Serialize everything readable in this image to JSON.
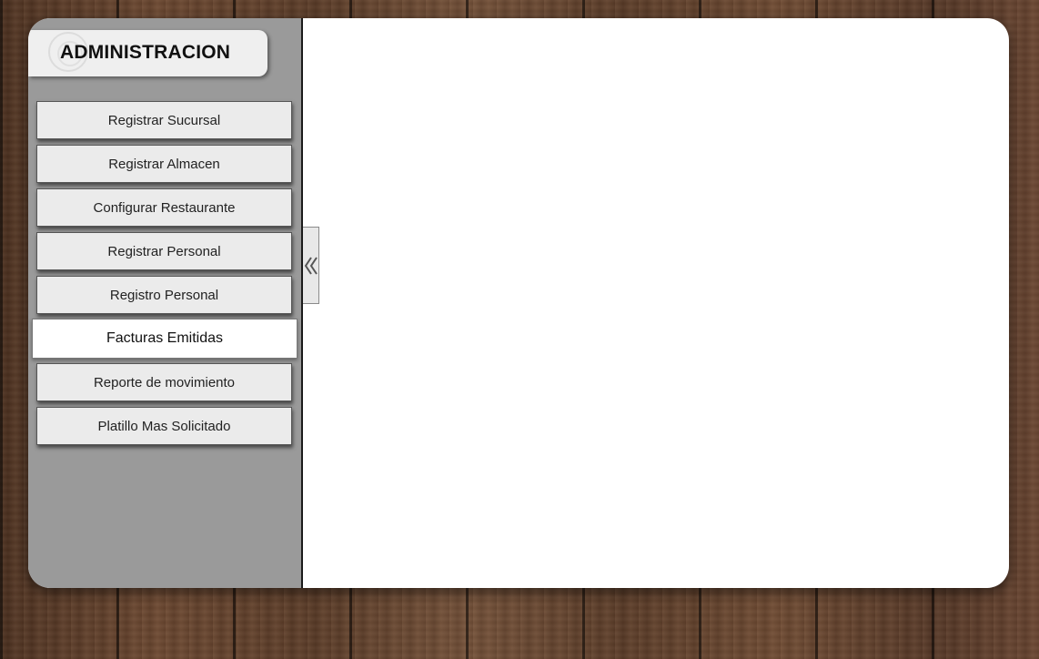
{
  "header": {
    "title": "ADMINISTRACION",
    "logo_icon": "logo-emblem-icon"
  },
  "menu": {
    "items": [
      {
        "label": "Registrar Sucursal",
        "active": false
      },
      {
        "label": "Registrar Almacen",
        "active": false
      },
      {
        "label": "Configurar Restaurante",
        "active": false
      },
      {
        "label": "Registrar Personal",
        "active": false
      },
      {
        "label": "Registro Personal",
        "active": false
      },
      {
        "label": "Facturas Emitidas",
        "active": true
      },
      {
        "label": "Reporte de movimiento",
        "active": false
      },
      {
        "label": "Platillo Mas Solicitado",
        "active": false
      }
    ]
  },
  "collapse_toggle": {
    "icon": "double-chevron-left-icon"
  },
  "colors": {
    "sidebar_bg": "#9a9a9a",
    "button_bg": "#ebebeb",
    "active_button_bg": "#ffffff",
    "content_bg": "#ffffff"
  }
}
